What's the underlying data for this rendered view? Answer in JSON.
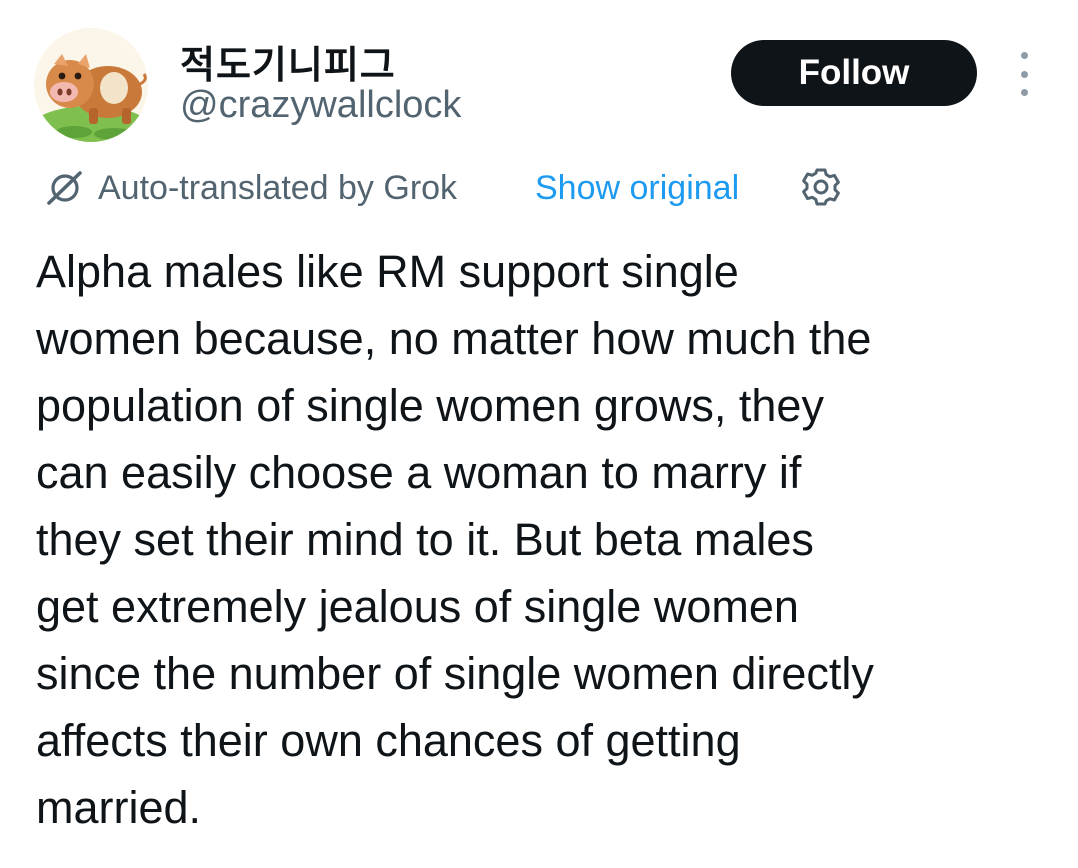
{
  "author": {
    "display_name": "적도기니피그",
    "handle": "@crazywallclock",
    "avatar_icon": "pig-avatar-icon"
  },
  "actions": {
    "follow_label": "Follow",
    "more_icon": "more-options-icon"
  },
  "translation": {
    "icon": "grok-icon",
    "label": "Auto-translated by Grok",
    "show_original_label": "Show original",
    "settings_icon": "gear-icon"
  },
  "post": {
    "text": "Alpha males like RM support single\nwomen because, no matter how much the\npopulation of single women grows, they\ncan easily choose a woman to marry if\nthey set their mind to it. But beta males\nget extremely jealous of single women\nsince the number of single women directly\naffects their own chances of getting\nmarried."
  },
  "colors": {
    "text_primary": "#0f1419",
    "text_secondary": "#536471",
    "link": "#1d9bf0",
    "follow_bg": "#0f1419"
  }
}
